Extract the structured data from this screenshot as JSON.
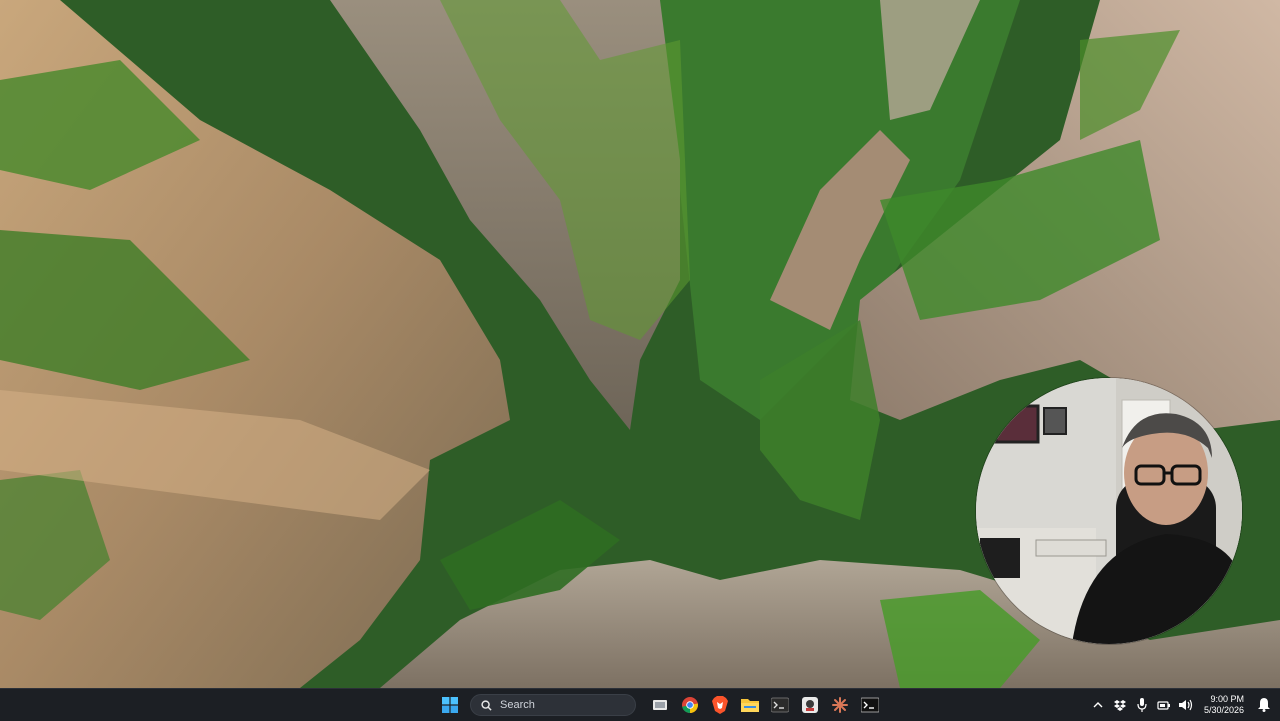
{
  "desktop": {
    "wallpaper": "canyon-forest-wallpaper"
  },
  "webcam": {
    "label": "webcam-overlay"
  },
  "taskbar": {
    "start_icon": "windows-start-icon",
    "search": {
      "label": "Search",
      "icon": "search-icon"
    },
    "pinned_apps": [
      {
        "name": "task-view-icon"
      },
      {
        "name": "chrome-icon"
      },
      {
        "name": "brave-icon"
      },
      {
        "name": "file-explorer-icon"
      },
      {
        "name": "terminal-icon"
      },
      {
        "name": "app-icon"
      },
      {
        "name": "claude-icon"
      },
      {
        "name": "console-icon"
      }
    ],
    "tray": {
      "time": "9:00 PM",
      "date": "5/30/2026",
      "icons": [
        "chevron-up-icon",
        "dropbox-icon",
        "microphone-icon",
        "battery-icon",
        "speaker-icon",
        "notification-icon"
      ]
    }
  },
  "colors": {
    "taskbar_bg": "#1c1f24",
    "accent": "#4cc2ff"
  }
}
